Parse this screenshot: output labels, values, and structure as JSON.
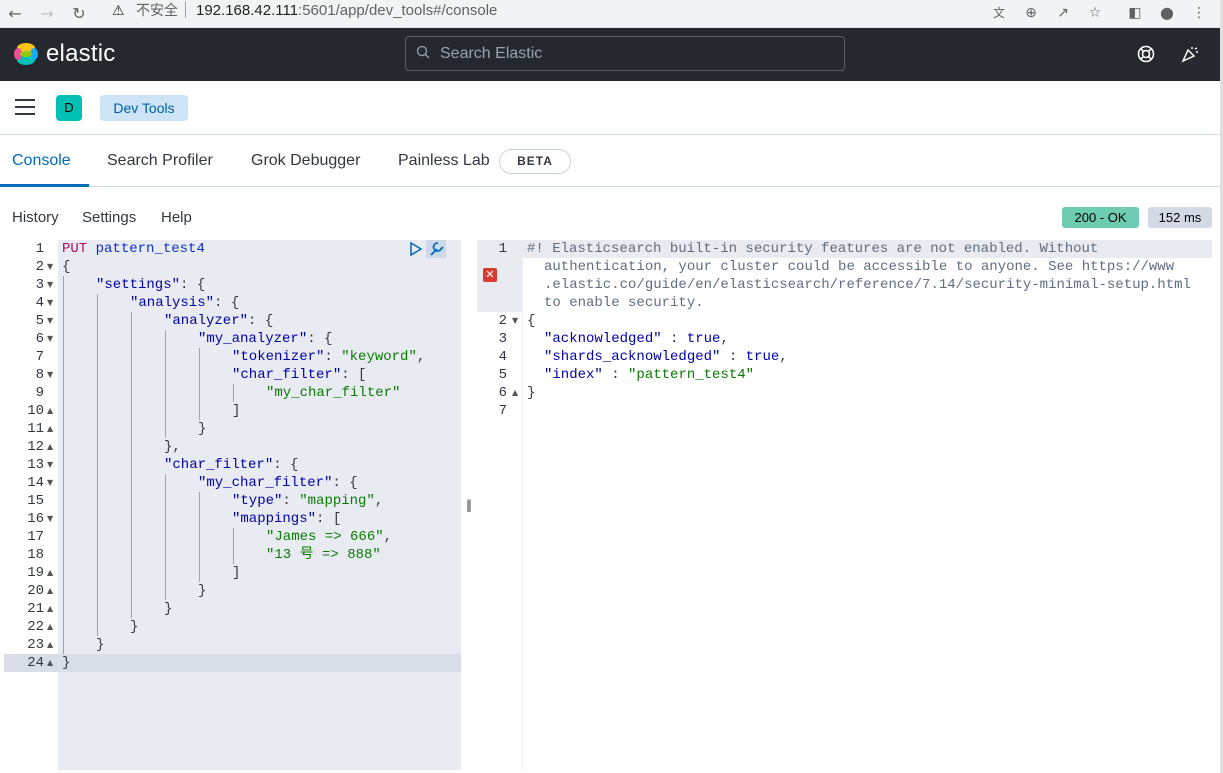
{
  "browser": {
    "security_label": "不安全",
    "url_host": "192.168.42.111",
    "url_path": ":5601/app/dev_tools#/console",
    "icons": [
      "back-icon",
      "forward-icon",
      "reload-icon",
      "warning-icon",
      "translate-icon",
      "zoom-icon",
      "share-icon",
      "star-icon",
      "sidepanel-icon",
      "profile-icon",
      "menu-dots-icon"
    ]
  },
  "header": {
    "brand": "elastic",
    "search_placeholder": "Search Elastic",
    "colors": {
      "bg": "#25282f",
      "accent": "#006bb8"
    }
  },
  "breadcrumbs": {
    "space_initial": "D",
    "current": "Dev Tools"
  },
  "tabs": [
    {
      "label": "Console",
      "active": true
    },
    {
      "label": "Search Profiler",
      "active": false
    },
    {
      "label": "Grok Debugger",
      "active": false
    },
    {
      "label": "Painless Lab",
      "active": false
    }
  ],
  "beta_badge": "BETA",
  "console_menu": {
    "history": "History",
    "settings": "Settings",
    "help": "Help"
  },
  "status": {
    "code": "200 - OK",
    "time": "152 ms",
    "color": "#6dccb1"
  },
  "request_editor": {
    "line_numbers": [
      "1",
      "2",
      "3",
      "4",
      "5",
      "6",
      "7",
      "8",
      "9",
      "10",
      "11",
      "12",
      "13",
      "14",
      "15",
      "16",
      "17",
      "18",
      "19",
      "20",
      "21",
      "22",
      "23",
      "24"
    ],
    "method": "PUT",
    "endpoint": "pattern_test4",
    "keys": {
      "settings": "\"settings\"",
      "analysis": "\"analysis\"",
      "analyzer": "\"analyzer\"",
      "my_analyzer": "\"my_analyzer\"",
      "tokenizer": "\"tokenizer\"",
      "char_filter": "\"char_filter\"",
      "char_filter2": "\"char_filter\"",
      "my_char_filter_key": "\"my_char_filter\"",
      "type": "\"type\"",
      "mappings": "\"mappings\""
    },
    "values": {
      "keyword": "\"keyword\"",
      "my_char_filter": "\"my_char_filter\"",
      "mapping": "\"mapping\"",
      "map1": "\"James => 666\"",
      "map2": "\"13 号 => 888\""
    }
  },
  "response_editor": {
    "line_numbers": [
      "1",
      "2",
      "3",
      "4",
      "5",
      "6",
      "7"
    ],
    "comment_lines": [
      "#! Elasticsearch built-in security features are not enabled. Without",
      "authentication, your cluster could be accessible to anyone. See https://www",
      ".elastic.co/guide/en/elasticsearch/reference/7.14/security-minimal-setup.html",
      "to enable security."
    ],
    "acknowledged_key": "\"acknowledged\"",
    "acknowledged_val": "true",
    "shards_key": "\"shards_acknowledged\"",
    "shards_val": "true",
    "index_key": "\"index\"",
    "index_val": "\"pattern_test4\""
  }
}
